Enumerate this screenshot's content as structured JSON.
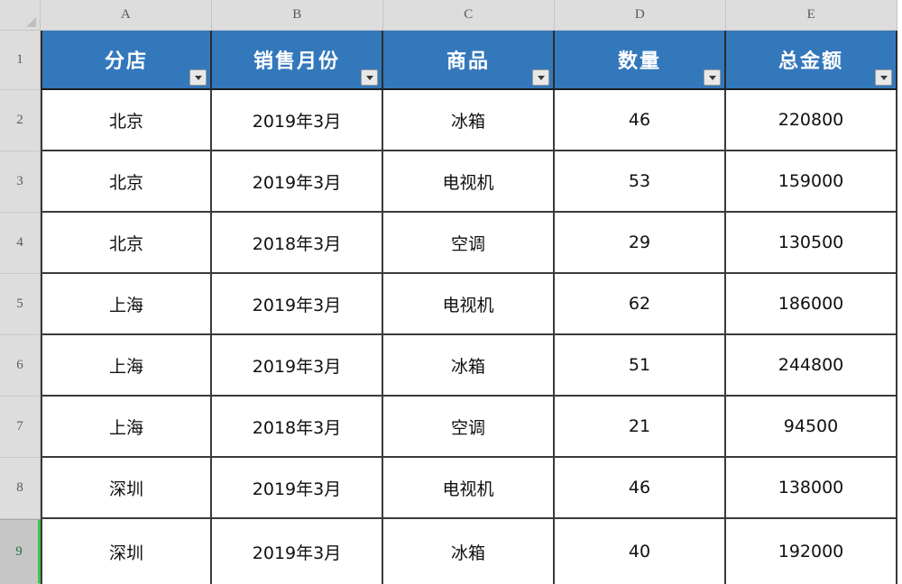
{
  "app": {
    "type": "spreadsheet",
    "select_all_corner": "select-all-triangle"
  },
  "column_headers": [
    "A",
    "B",
    "C",
    "D",
    "E"
  ],
  "row_headers": [
    "1",
    "2",
    "3",
    "4",
    "5",
    "6",
    "7",
    "8",
    "9"
  ],
  "active_row": "9",
  "colors": {
    "table_header_bg": "#3478bc",
    "table_header_text": "#ffffff",
    "grid_header_bg": "#dddddd",
    "active_row_bg": "#c6c6c6",
    "active_row_text": "#217346",
    "active_row_accent": "#3ec34f",
    "cell_border": "#3a3a3a",
    "cell_bg": "#ffffff"
  },
  "table": {
    "has_autofilter": true,
    "filter_icon": "filter-dropdown-icon",
    "headers": [
      "分店",
      "销售月份",
      "商品",
      "数量",
      "总金额"
    ],
    "rows": [
      [
        "北京",
        "2019年3月",
        "冰箱",
        "46",
        "220800"
      ],
      [
        "北京",
        "2019年3月",
        "电视机",
        "53",
        "159000"
      ],
      [
        "北京",
        "2018年3月",
        "空调",
        "29",
        "130500"
      ],
      [
        "上海",
        "2019年3月",
        "电视机",
        "62",
        "186000"
      ],
      [
        "上海",
        "2019年3月",
        "冰箱",
        "51",
        "244800"
      ],
      [
        "上海",
        "2018年3月",
        "空调",
        "21",
        "94500"
      ],
      [
        "深圳",
        "2019年3月",
        "电视机",
        "46",
        "138000"
      ],
      [
        "深圳",
        "2019年3月",
        "冰箱",
        "40",
        "192000"
      ]
    ]
  }
}
